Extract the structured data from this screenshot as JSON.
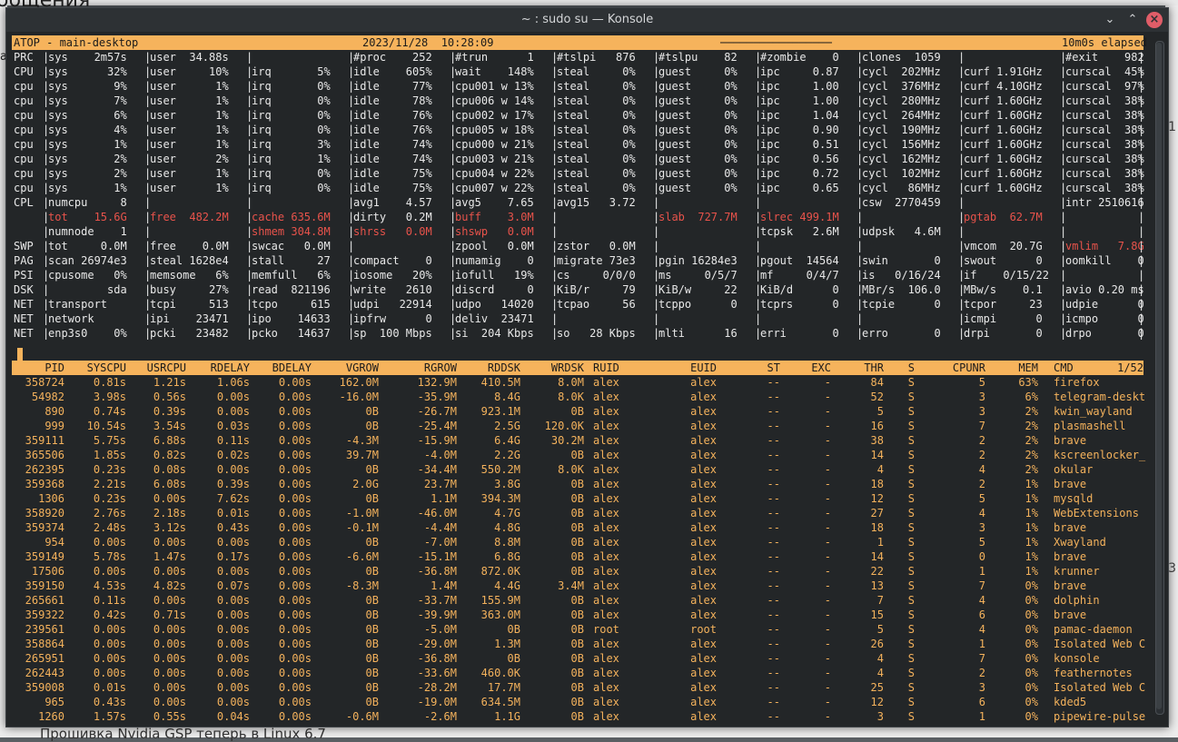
{
  "background": {
    "top_text": "общения",
    "side_text": "al",
    "bottom_text": "Прошивка Nvidia GSP теперь в Linux 6.7",
    "marks": [
      "1",
      "3"
    ]
  },
  "window": {
    "title": "~ : sudo su — Konsole",
    "min_icon": "chevron-down",
    "max_icon": "chevron-up",
    "close_icon": "close"
  },
  "header": {
    "left": "ATOP - main-desktop",
    "datetime": "2023/11/28  10:28:09",
    "dashes": "─────────────────",
    "elapsed": "10m0s elapsed"
  },
  "colors": {
    "accent": "#f6b35c",
    "warn": "#e8534b",
    "bg": "#232628"
  },
  "sys_lines": [
    [
      "PRC | sys    2m57s | user  34.88s |              | #proc    252 | #trun      1 | #tslpi   876 | #tslpu    82 | #zombie    0 | clones  1059 |              | #exit    982 |",
      []
    ],
    [
      "CPU | sys      32% | user     10% | irq       5% | idle    605% | wait    148% | steal     0% | guest     0% | ipc     0.87 | cycl  202MHz | curf 1.91GHz | curscal  45% |",
      []
    ],
    [
      "cpu | sys       9% | user      1% | irq       0% | idle     77% | cpu001 w 13% | steal     0% | guest     0% | ipc     1.00 | cycl  376MHz | curf 4.10GHz | curscal  97% |",
      []
    ],
    [
      "cpu | sys       7% | user      1% | irq       0% | idle     78% | cpu006 w 14% | steal     0% | guest     0% | ipc     1.00 | cycl  280MHz | curf 1.60GHz | curscal  38% |",
      []
    ],
    [
      "cpu | sys       6% | user      1% | irq       0% | idle     76% | cpu002 w 17% | steal     0% | guest     0% | ipc     1.04 | cycl  264MHz | curf 1.60GHz | curscal  38% |",
      []
    ],
    [
      "cpu | sys       4% | user      1% | irq       0% | idle     76% | cpu005 w 18% | steal     0% | guest     0% | ipc     0.90 | cycl  190MHz | curf 1.60GHz | curscal  38% |",
      []
    ],
    [
      "cpu | sys       1% | user      1% | irq       3% | idle     74% | cpu000 w 21% | steal     0% | guest     0% | ipc     0.51 | cycl  156MHz | curf 1.60GHz | curscal  38% |",
      []
    ],
    [
      "cpu | sys       2% | user      2% | irq       1% | idle     74% | cpu003 w 21% | steal     0% | guest     0% | ipc     0.56 | cycl  162MHz | curf 1.60GHz | curscal  38% |",
      []
    ],
    [
      "cpu | sys       2% | user      1% | irq       0% | idle     75% | cpu004 w 22% | steal     0% | guest     0% | ipc     0.72 | cycl  102MHz | curf 1.60GHz | curscal  38% |",
      []
    ],
    [
      "cpu | sys       1% | user      1% | irq       0% | idle     75% | cpu007 w 22% | steal     0% | guest     0% | ipc     0.65 | cycl   86MHz | curf 1.60GHz | curscal  38% |",
      []
    ],
    [
      "CPL | numcpu     8 |              |              | avg1    4.57 | avg5    7.65 | avg15   3.72 |              |              | csw  2770459 |              | intr 2510616 |",
      []
    ],
    [
      "    | tot    15.6G | free  482.2M | cache 635.6M | dirty   0.2M | buff    3.0M |              | slab  727.7M | slrec 499.1M |              | pgtab  62.7M |              |",
      [
        1,
        2,
        3,
        5,
        7,
        8,
        10
      ]
    ],
    [
      "    | numnode    1 |              | shmem 304.8M | shrss   0.0M | shswp   0.0M |              |              | tcpsk   2.6M | udpsk   4.6M |              |              |",
      [
        3,
        4,
        5
      ]
    ],
    [
      "SWP | tot     0.0M | free    0.0M | swcac   0.0M |              | zpool   0.0M | zstor   0.0M |              |              |              | vmcom  20.7G | vmlim   7.8G |",
      [
        11
      ]
    ],
    [
      "PAG | scan 26974e3 | steal 1628e4 | stall     27 | compact    0 | numamig    0 | migrate 73e3 | pgin 16284e3 | pgout  14564 | swin       0 | swout      0 | oomkill    0 |",
      []
    ],
    [
      "PSI | cpusome   0% | memsome   6% | memfull   6% | iosome   20% | iofull   19% | cs     0/0/0 | ms     0/5/7 | mf     0/4/7 | is   0/16/24 | if    0/15/22 |              |",
      []
    ],
    [
      "DSK |          sda | busy     27% | read  821196 | write   2610 | discrd     0 | KiB/r     79 | KiB/w     22 | KiB/d      0 | MBr/s  106.0 | MBw/s    0.1 | avio 0.20 ms |",
      []
    ],
    [
      "NET | transport    | tcpi     513 | tcpo     615 | udpi   22914 | udpo   14020 | tcpao     56 | tcppo      0 | tcprs      0 | tcpie      0 | tcpor     23 | udpie      0 |",
      []
    ],
    [
      "NET | network      | ipi    23471 | ipo    14633 | ipfrw      0 | deliv  23471 |              |              |              |              | icmpi      0 | icmpo      0 |",
      []
    ],
    [
      "NET | enp3s0    0% | pcki   23482 | pcko   14637 | sp  100 Mbps | si  204 Kbps | so   28 Kbps | mlti      16 | erri       0 | erro       0 | drpi       0 | drpo       0 |",
      []
    ]
  ],
  "columns": [
    "PID",
    "SYSCPU",
    "USRCPU",
    "RDELAY",
    "BDELAY",
    "VGROW",
    "RGROW",
    "RDDSK",
    "WRDSK",
    "RUID",
    "EUID",
    "ST",
    "EXC",
    "THR",
    "S",
    "CPUNR",
    "MEM",
    "CMD"
  ],
  "page_indicator": "1/52",
  "processes": [
    [
      "358724",
      "0.81s",
      "1.21s",
      "1.06s",
      "0.00s",
      "162.0M",
      "132.9M",
      "410.5M",
      "8.0M",
      "alex",
      "alex",
      "--",
      "-",
      "84",
      "S",
      "5",
      "63%",
      "firefox"
    ],
    [
      "54982",
      "3.98s",
      "0.56s",
      "0.00s",
      "0.00s",
      "-16.0M",
      "-35.9M",
      "8.4G",
      "8.0K",
      "alex",
      "alex",
      "--",
      "-",
      "52",
      "S",
      "3",
      "6%",
      "telegram-deskt"
    ],
    [
      "890",
      "0.74s",
      "0.39s",
      "0.00s",
      "0.00s",
      "0B",
      "-26.7M",
      "923.1M",
      "0B",
      "alex",
      "alex",
      "--",
      "-",
      "5",
      "S",
      "3",
      "2%",
      "kwin_wayland"
    ],
    [
      "999",
      "10.54s",
      "3.54s",
      "0.03s",
      "0.00s",
      "0B",
      "-25.4M",
      "2.5G",
      "120.0K",
      "alex",
      "alex",
      "--",
      "-",
      "16",
      "S",
      "7",
      "2%",
      "plasmashell"
    ],
    [
      "359111",
      "5.75s",
      "6.88s",
      "0.11s",
      "0.00s",
      "-4.3M",
      "-15.9M",
      "6.4G",
      "30.2M",
      "alex",
      "alex",
      "--",
      "-",
      "38",
      "S",
      "2",
      "2%",
      "brave"
    ],
    [
      "365506",
      "1.85s",
      "0.82s",
      "0.02s",
      "0.00s",
      "39.7M",
      "-4.0M",
      "2.2G",
      "0B",
      "alex",
      "alex",
      "--",
      "-",
      "14",
      "S",
      "2",
      "2%",
      "kscreenlocker_"
    ],
    [
      "262395",
      "0.23s",
      "0.08s",
      "0.00s",
      "0.00s",
      "0B",
      "-34.4M",
      "550.2M",
      "8.0K",
      "alex",
      "alex",
      "--",
      "-",
      "4",
      "S",
      "4",
      "2%",
      "okular"
    ],
    [
      "359368",
      "2.21s",
      "6.08s",
      "0.39s",
      "0.00s",
      "2.0G",
      "23.7M",
      "3.8G",
      "0B",
      "alex",
      "alex",
      "--",
      "-",
      "18",
      "S",
      "2",
      "1%",
      "brave"
    ],
    [
      "1306",
      "0.23s",
      "0.00s",
      "7.62s",
      "0.00s",
      "0B",
      "1.1M",
      "394.3M",
      "0B",
      "alex",
      "alex",
      "--",
      "-",
      "12",
      "S",
      "5",
      "1%",
      "mysqld"
    ],
    [
      "358920",
      "2.76s",
      "2.18s",
      "0.01s",
      "0.00s",
      "-1.0M",
      "-46.0M",
      "4.7G",
      "0B",
      "alex",
      "alex",
      "--",
      "-",
      "27",
      "S",
      "4",
      "1%",
      "WebExtensions"
    ],
    [
      "359374",
      "2.48s",
      "3.12s",
      "0.43s",
      "0.00s",
      "-0.1M",
      "-4.4M",
      "4.8G",
      "0B",
      "alex",
      "alex",
      "--",
      "-",
      "18",
      "S",
      "3",
      "1%",
      "brave"
    ],
    [
      "954",
      "0.00s",
      "0.00s",
      "0.00s",
      "0.00s",
      "0B",
      "-7.0M",
      "8.8M",
      "0B",
      "alex",
      "alex",
      "--",
      "-",
      "1",
      "S",
      "5",
      "1%",
      "Xwayland"
    ],
    [
      "359149",
      "5.78s",
      "1.47s",
      "0.17s",
      "0.00s",
      "-6.6M",
      "-15.1M",
      "6.8G",
      "0B",
      "alex",
      "alex",
      "--",
      "-",
      "14",
      "S",
      "0",
      "1%",
      "brave"
    ],
    [
      "17506",
      "0.00s",
      "0.00s",
      "0.00s",
      "0.00s",
      "0B",
      "-36.8M",
      "872.0K",
      "0B",
      "alex",
      "alex",
      "--",
      "-",
      "22",
      "S",
      "1",
      "1%",
      "krunner"
    ],
    [
      "359150",
      "4.53s",
      "4.82s",
      "0.07s",
      "0.00s",
      "-8.3M",
      "1.4M",
      "4.4G",
      "3.4M",
      "alex",
      "alex",
      "--",
      "-",
      "13",
      "S",
      "7",
      "0%",
      "brave"
    ],
    [
      "265661",
      "0.11s",
      "0.00s",
      "0.00s",
      "0.00s",
      "0B",
      "-33.7M",
      "155.9M",
      "0B",
      "alex",
      "alex",
      "--",
      "-",
      "7",
      "S",
      "4",
      "0%",
      "dolphin"
    ],
    [
      "359322",
      "0.42s",
      "0.71s",
      "0.00s",
      "0.00s",
      "0B",
      "-39.9M",
      "363.0M",
      "0B",
      "alex",
      "alex",
      "--",
      "-",
      "15",
      "S",
      "6",
      "0%",
      "brave"
    ],
    [
      "239561",
      "0.00s",
      "0.00s",
      "0.00s",
      "0.00s",
      "0B",
      "-5.0M",
      "0B",
      "0B",
      "root",
      "root",
      "--",
      "-",
      "5",
      "S",
      "4",
      "0%",
      "pamac-daemon"
    ],
    [
      "358864",
      "0.00s",
      "0.00s",
      "0.00s",
      "0.00s",
      "0B",
      "-29.0M",
      "1.3M",
      "0B",
      "alex",
      "alex",
      "--",
      "-",
      "26",
      "S",
      "1",
      "0%",
      "Isolated Web C"
    ],
    [
      "265951",
      "0.00s",
      "0.00s",
      "0.00s",
      "0.00s",
      "0B",
      "-36.8M",
      "0B",
      "0B",
      "alex",
      "alex",
      "--",
      "-",
      "4",
      "S",
      "7",
      "0%",
      "konsole"
    ],
    [
      "262443",
      "0.00s",
      "0.00s",
      "0.00s",
      "0.00s",
      "0B",
      "-33.6M",
      "460.0K",
      "0B",
      "alex",
      "alex",
      "--",
      "-",
      "4",
      "S",
      "2",
      "0%",
      "feathernotes"
    ],
    [
      "359008",
      "0.01s",
      "0.00s",
      "0.00s",
      "0.00s",
      "0B",
      "-28.2M",
      "17.7M",
      "0B",
      "alex",
      "alex",
      "--",
      "-",
      "25",
      "S",
      "3",
      "0%",
      "Isolated Web C"
    ],
    [
      "965",
      "0.43s",
      "0.00s",
      "0.00s",
      "0.00s",
      "0B",
      "-19.0M",
      "634.5M",
      "0B",
      "alex",
      "alex",
      "--",
      "-",
      "12",
      "S",
      "6",
      "0%",
      "kded5"
    ],
    [
      "1260",
      "1.57s",
      "0.55s",
      "0.04s",
      "0.00s",
      "-0.6M",
      "-2.6M",
      "1.1G",
      "0B",
      "alex",
      "alex",
      "--",
      "-",
      "3",
      "S",
      "1",
      "0%",
      "pipewire-pulse"
    ]
  ]
}
